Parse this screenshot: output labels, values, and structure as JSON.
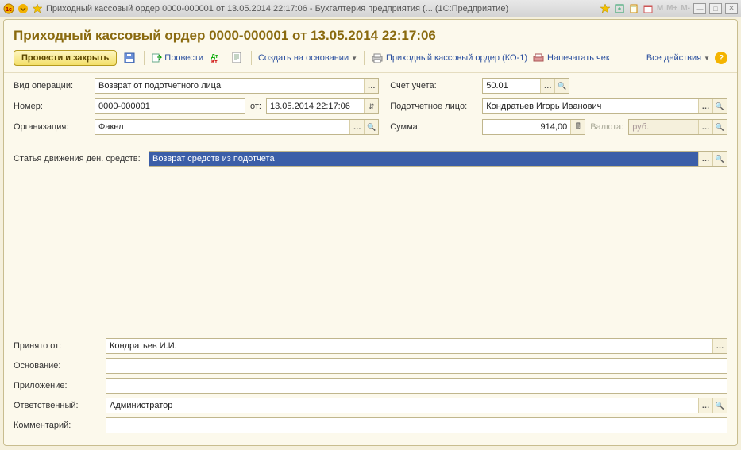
{
  "titlebar": {
    "title": "Приходный кассовый ордер 0000-000001 от 13.05.2014 22:17:06 - Бухгалтерия предприятия (...  (1С:Предприятие)"
  },
  "header": {
    "title": "Приходный кассовый ордер 0000-000001 от 13.05.2014 22:17:06"
  },
  "toolbar": {
    "post_close": "Провести и закрыть",
    "post": "Провести",
    "create_based": "Создать на основании",
    "print_ko1": "Приходный кассовый ордер (КО-1)",
    "print_check": "Напечатать чек",
    "all_actions": "Все действия"
  },
  "labels": {
    "op_type": "Вид операции:",
    "number": "Номер:",
    "from": "от:",
    "org": "Организация:",
    "account": "Счет учета:",
    "person": "Подотчетное лицо:",
    "sum": "Сумма:",
    "currency": "Валюта:",
    "flow": "Статья движения ден. средств:",
    "received_from": "Принято от:",
    "basis": "Основание:",
    "attachment": "Приложение:",
    "responsible": "Ответственный:",
    "comment": "Комментарий:"
  },
  "values": {
    "op_type": "Возврат от подотчетного лица",
    "number": "0000-000001",
    "date": "13.05.2014 22:17:06",
    "org": "Факел",
    "account": "50.01",
    "person": "Кондратьев Игорь Иванович",
    "sum": "914,00",
    "currency": "руб.",
    "flow": "Возврат средств из подотчета",
    "received_from": "Кондратьев И.И.",
    "basis": "",
    "attachment": "",
    "responsible": "Администратор",
    "comment": ""
  }
}
